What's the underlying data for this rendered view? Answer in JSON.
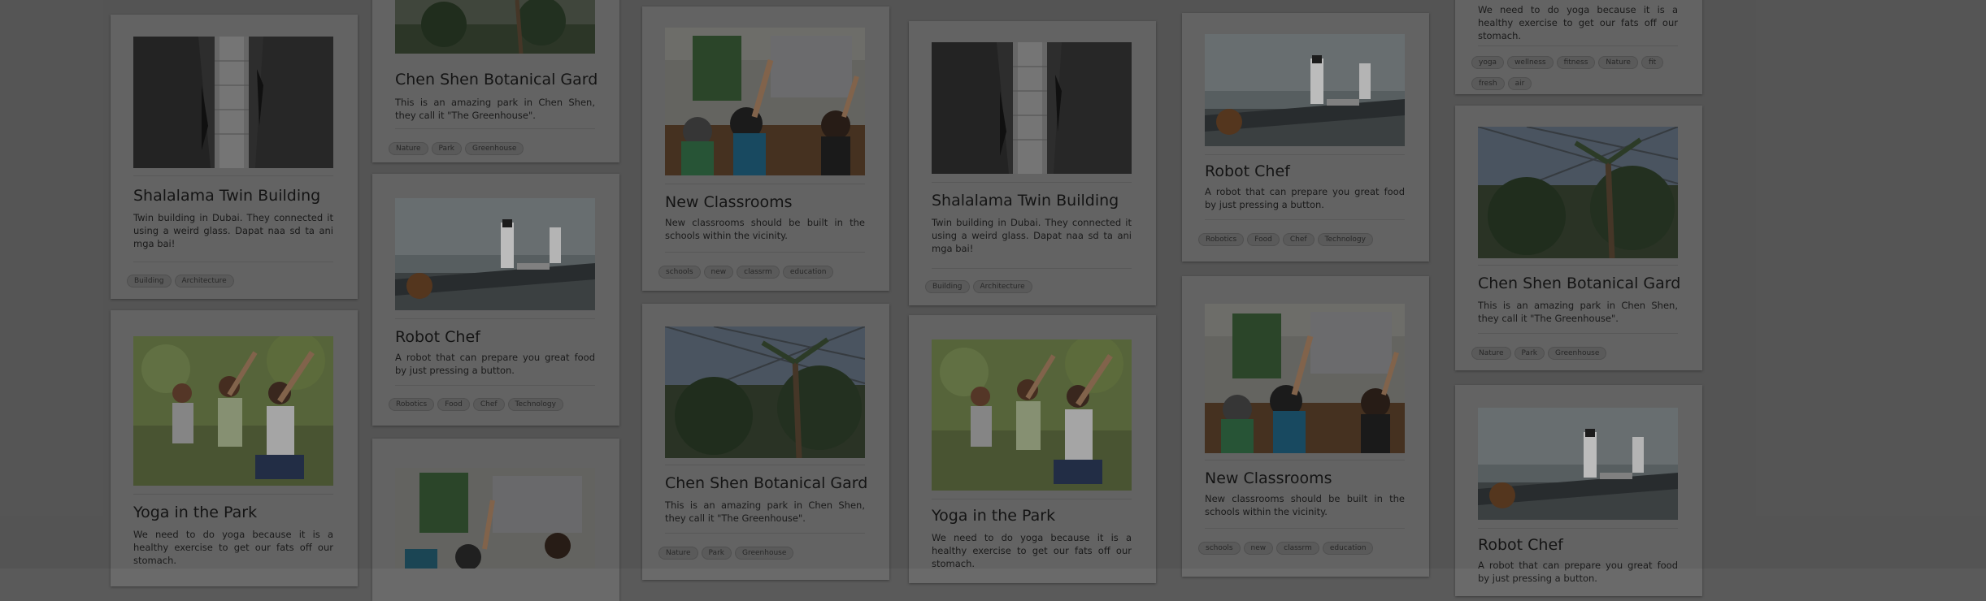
{
  "posts": {
    "building": {
      "title": "Shalalama Twin Building",
      "description": "Twin building in Dubai. They connected it using a weird glass. Dapat naa sd ta ani mga bai!",
      "tags": [
        "Building",
        "Architecture"
      ]
    },
    "botanical": {
      "title": "Chen Shen Botanical Garden",
      "description": "This is an amazing park in Chen Shen, they call it \"The Greenhouse\".",
      "tags": [
        "Nature",
        "Park",
        "Greenhouse"
      ]
    },
    "robot": {
      "title": "Robot Chef",
      "description": "A robot that can prepare you great food by just pressing a button.",
      "tags": [
        "Robotics",
        "Food",
        "Chef",
        "Technology"
      ]
    },
    "classrooms": {
      "title": "New Classrooms",
      "description": "New classrooms should be built in the schools within the vicinity.",
      "tags": [
        "schools",
        "new",
        "classrm",
        "education"
      ]
    },
    "yoga": {
      "title": "Yoga in the Park",
      "description": "We need to do yoga because it is a healthy exercise to get our fats off our stomach.",
      "tags": [
        "yoga",
        "wellness",
        "fitness",
        "Nature",
        "fit",
        "fresh",
        "air"
      ]
    }
  }
}
